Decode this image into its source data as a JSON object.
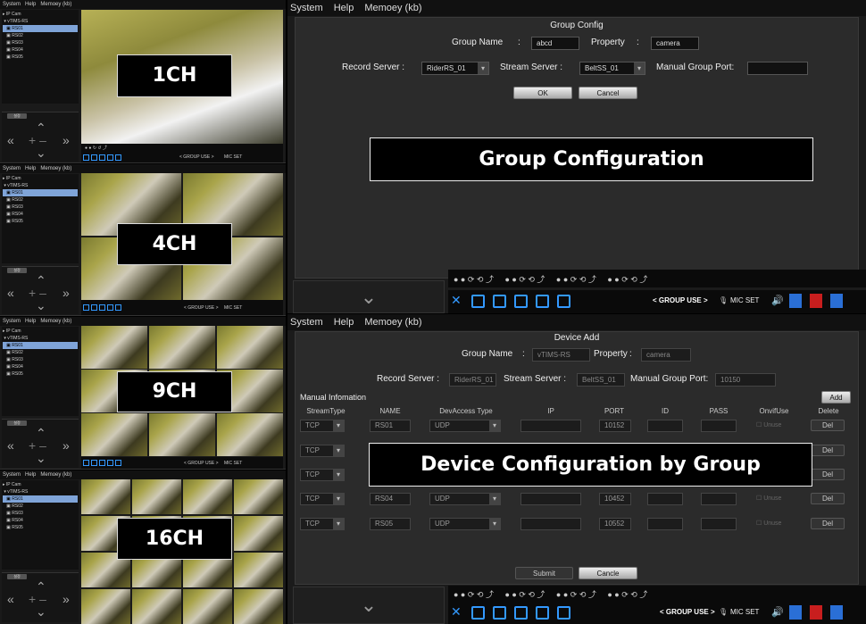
{
  "left_menu": [
    "System",
    "Help",
    "Memoey (kb)"
  ],
  "tree": {
    "root": "IP Cam",
    "server": "vTIMS-RS",
    "items": [
      "RS01",
      "RS02",
      "RS03",
      "RS04",
      "RS05"
    ]
  },
  "tree_root_first": "IP Cam",
  "tree_server_first": "vTIMS-RS",
  "ptz_button": "설정",
  "ch_labels": [
    "1CH",
    "4CH",
    "9CH",
    "16CH"
  ],
  "ctrl": {
    "group_use": "< GROUP USE >",
    "mic_set": "MIC SET"
  },
  "top_window": {
    "menu": [
      "System",
      "Help",
      "Memoey (kb)"
    ],
    "title": "Group Config",
    "group_name_label": "Group  Name",
    "group_name_value": "abcd",
    "property_label": "Property",
    "property_value": "camera",
    "record_server_label": "Record Server :",
    "record_server_value": "RiderRS_01",
    "stream_server_label": "Stream Server :",
    "stream_server_value": "BeltSS_01",
    "manual_group_port_label": "Manual Group Port:",
    "manual_group_port_value": "",
    "ok": "OK",
    "cancel": "Cancel",
    "overlay": "Group Configuration"
  },
  "bottom_window": {
    "menu": [
      "System",
      "Help",
      "Memoey (kb)"
    ],
    "title": "Device Add",
    "group_name_label": "Group  Name",
    "group_name_value": "vTIMS-RS",
    "property_label": "Property",
    "property_value": "camera",
    "record_server_label": "Record Server :",
    "record_server_value": "RiderRS_01",
    "stream_server_label": "Stream Server :",
    "stream_server_value": "BeltSS_01",
    "manual_group_port_label": "Manual Group Port:",
    "manual_group_port_value": "10150",
    "manual_info_label": "Manual Infomation",
    "add": "Add",
    "columns": [
      "StreamType",
      "NAME",
      "DevAccess Type",
      "IP",
      "PORT",
      "ID",
      "PASS",
      "OnvifUse",
      "Delete"
    ],
    "rows": [
      {
        "stream": "TCP",
        "name": "RS01",
        "access": "UDP",
        "ip": "",
        "port": "10152",
        "id": "",
        "pass": "",
        "onvif": "Unuse",
        "del": "Del"
      },
      {
        "stream": "TCP",
        "name": "",
        "access": "",
        "ip": "",
        "port": "",
        "id": "",
        "pass": "",
        "onvif": "",
        "del": "Del"
      },
      {
        "stream": "TCP",
        "name": "",
        "access": "",
        "ip": "",
        "port": "",
        "id": "",
        "pass": "",
        "onvif": "",
        "del": "Del"
      },
      {
        "stream": "TCP",
        "name": "RS04",
        "access": "UDP",
        "ip": "",
        "port": "10452",
        "id": "",
        "pass": "",
        "onvif": "Unuse",
        "del": "Del"
      },
      {
        "stream": "TCP",
        "name": "RS05",
        "access": "UDP",
        "ip": "",
        "port": "10552",
        "id": "",
        "pass": "",
        "onvif": "Unuse",
        "del": "Del"
      }
    ],
    "submit": "Submit",
    "cancel": "Cancle",
    "overlay": "Device Configuration by Group"
  },
  "bottom_bar": {
    "group_use": "< GROUP USE >",
    "mic_set": "MIC SET"
  }
}
